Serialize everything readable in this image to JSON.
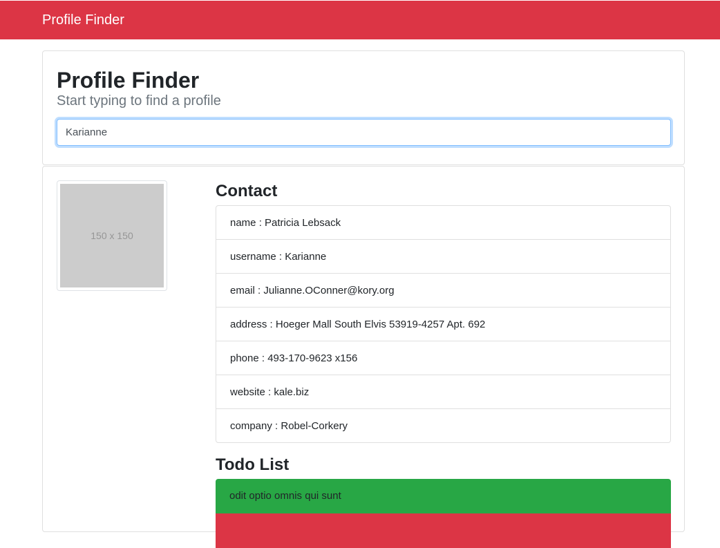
{
  "navbar": {
    "brand": "Profile Finder"
  },
  "search": {
    "title": "Profile Finder",
    "subtitle": "Start typing to find a profile",
    "value": "Karianne"
  },
  "profile": {
    "image_placeholder": "150 x 150",
    "contact_title": "Contact",
    "contact": [
      "name : Patricia Lebsack",
      "username : Karianne",
      "email : Julianne.OConner@kory.org",
      "address : Hoeger Mall South Elvis 53919-4257 Apt. 692",
      "phone : 493-170-9623 x156",
      "website : kale.biz",
      "company : Robel-Corkery"
    ],
    "todo_title": "Todo List",
    "todos": [
      {
        "text": "odit optio omnis qui sunt",
        "completed": true,
        "color": "#28a745"
      },
      {
        "text": "",
        "completed": false,
        "color": "#dc3545"
      }
    ]
  },
  "colors": {
    "navbar": "#dc3545",
    "completed": "#28a745",
    "incomplete": "#dc3545"
  }
}
